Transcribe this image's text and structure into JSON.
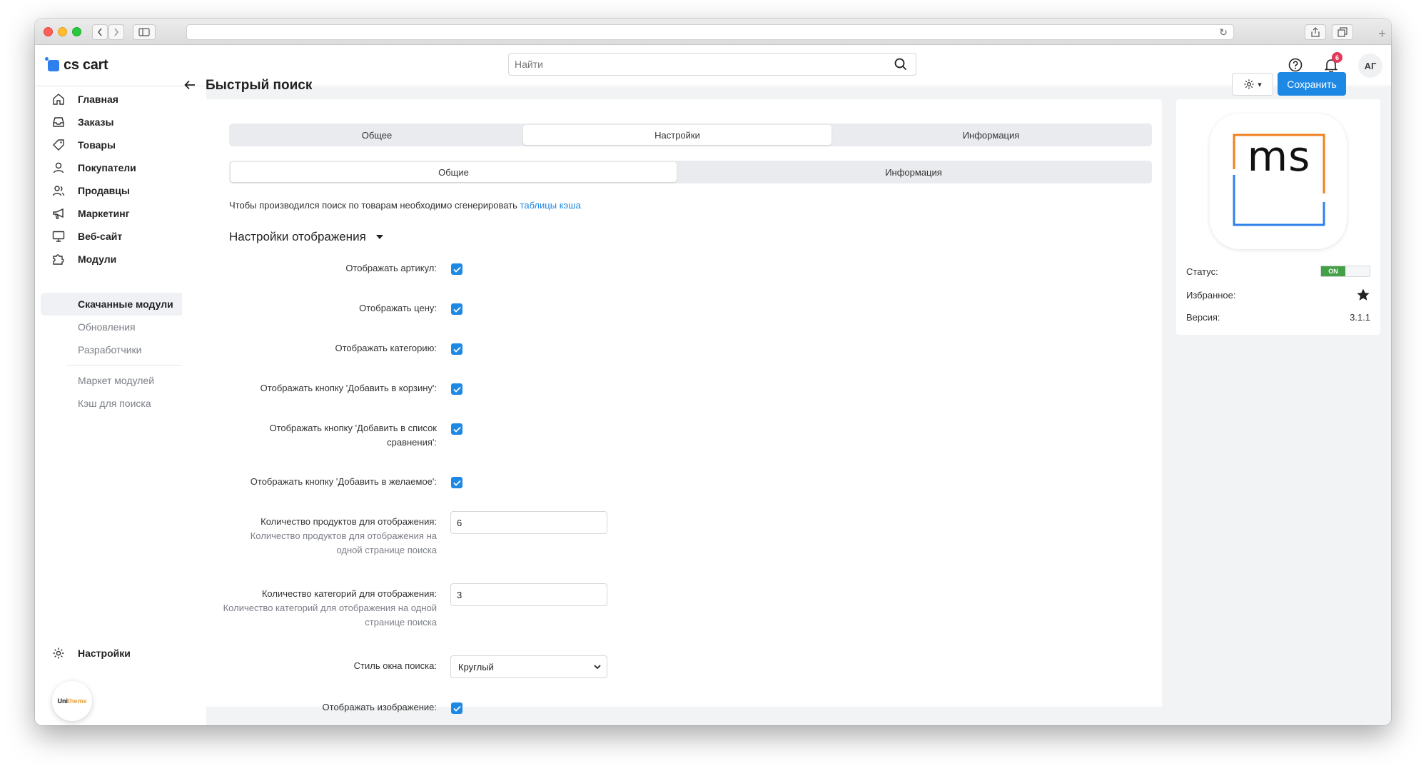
{
  "app": {
    "logo_text": "cs cart",
    "search_placeholder": "Найти",
    "notifications_count": "6",
    "user_initials": "АГ"
  },
  "sidebar": {
    "items": [
      {
        "label": "Главная",
        "icon": "home-icon"
      },
      {
        "label": "Заказы",
        "icon": "inbox-icon"
      },
      {
        "label": "Товары",
        "icon": "tag-icon"
      },
      {
        "label": "Покупатели",
        "icon": "user-icon"
      },
      {
        "label": "Продавцы",
        "icon": "users-icon"
      },
      {
        "label": "Маркетинг",
        "icon": "megaphone-icon"
      },
      {
        "label": "Веб-сайт",
        "icon": "monitor-icon"
      },
      {
        "label": "Модули",
        "icon": "puzzle-icon"
      }
    ],
    "subitems": [
      {
        "label": "Скачанные модули",
        "active": true
      },
      {
        "label": "Обновления",
        "active": false
      },
      {
        "label": "Разработчики",
        "active": false
      },
      {
        "label": "Маркет модулей",
        "active": false
      },
      {
        "label": "Кэш для поиска",
        "active": false
      }
    ],
    "settings_label": "Настройки",
    "unitheme_label_a": "Uni",
    "unitheme_label_b": "theme"
  },
  "page": {
    "title": "Быстрый поиск",
    "save_label": "Сохранить",
    "tabs": [
      {
        "label": "Общее",
        "active": false
      },
      {
        "label": "Настройки",
        "active": true
      },
      {
        "label": "Информация",
        "active": false
      }
    ],
    "subtabs": [
      {
        "label": "Общие",
        "active": true
      },
      {
        "label": "Информация",
        "active": false
      }
    ],
    "info_text": "Чтобы производился поиск по товарам необходимо сгенерировать ",
    "info_link": "таблицы кэша",
    "section_title": "Настройки отображения"
  },
  "settings": {
    "show_sku": {
      "label": "Отображать артикул:",
      "checked": true
    },
    "show_price": {
      "label": "Отображать цену:",
      "checked": true
    },
    "show_category": {
      "label": "Отображать категорию:",
      "checked": true
    },
    "show_add_to_cart": {
      "label": "Отображать кнопку 'Добавить в корзину':",
      "checked": true
    },
    "show_add_to_compare": {
      "label": "Отображать кнопку 'Добавить в список сравнения':",
      "checked": true
    },
    "show_add_to_wishlist": {
      "label": "Отображать кнопку 'Добавить в желаемое':",
      "checked": true
    },
    "products_count": {
      "label": "Количество продуктов для отображения:",
      "hint": "Количество продуктов для отображения на одной странице поиска",
      "value": "6"
    },
    "categories_count": {
      "label": "Количество категорий для отображения:",
      "hint": "Количество категорий для отображения на одной странице поиска",
      "value": "3"
    },
    "window_style": {
      "label": "Стиль окна поиска:",
      "value": "Круглый"
    },
    "show_image": {
      "label": "Отображать изображение:",
      "checked": true
    }
  },
  "addon": {
    "logo_text": "ms",
    "status_label": "Статус:",
    "status_value": "ON",
    "favorite_label": "Избранное:",
    "version_label": "Версия:",
    "version_value": "3.1.1",
    "colors": {
      "orange": "#f07f1e",
      "blue": "#2f80ed",
      "status_green": "#43a047",
      "accent": "#1e88e5"
    }
  }
}
